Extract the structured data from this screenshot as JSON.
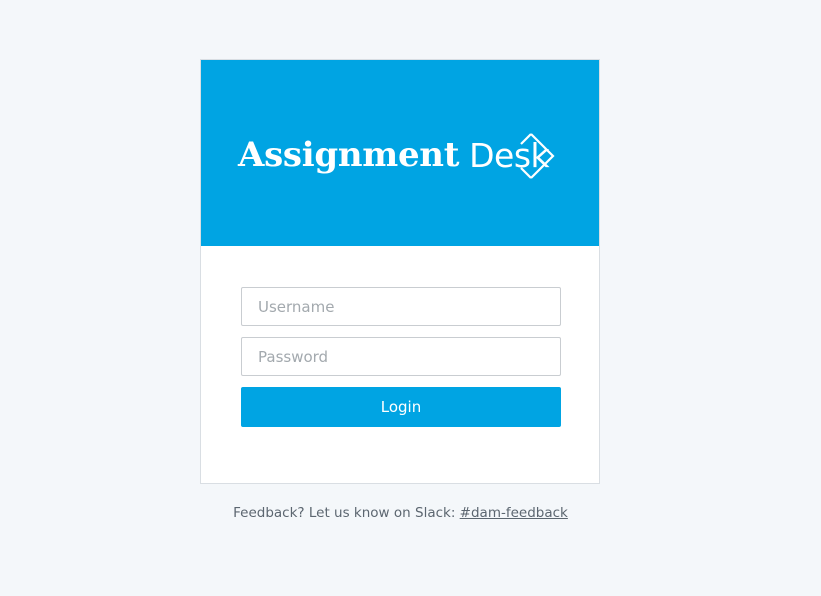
{
  "brand": {
    "name_part_1": "Assignment",
    "name_part_2": "Desk",
    "logo_icon": "diamond-chevron-icon",
    "color": "#00a4e3"
  },
  "login_form": {
    "username_placeholder": "Username",
    "username_value": "",
    "password_placeholder": "Password",
    "password_value": "",
    "login_label": "Login"
  },
  "footer": {
    "feedback_text": "Feedback? Let us know on Slack: ",
    "feedback_link_label": "#dam-feedback"
  }
}
